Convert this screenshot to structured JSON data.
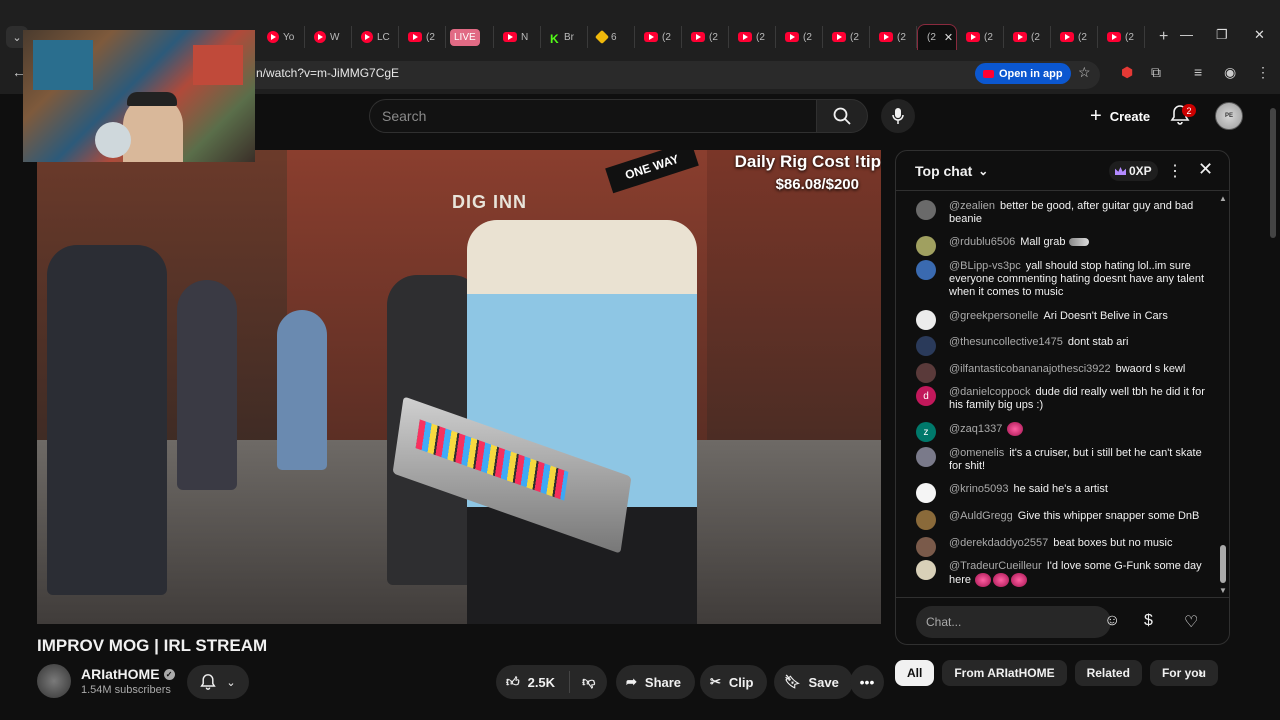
{
  "browser": {
    "tabs": [
      {
        "label": "Yo",
        "icon": "youtube-icon"
      },
      {
        "label": "W",
        "icon": "youtube-icon"
      },
      {
        "label": "LC",
        "icon": "youtube-icon"
      },
      {
        "label": "(2",
        "icon": "youtube-icon"
      },
      {
        "label": "LIVE",
        "icon": "live-badge"
      },
      {
        "label": "N",
        "icon": "youtube-icon"
      },
      {
        "label": "Br",
        "icon": "kick-icon"
      },
      {
        "label": "6",
        "icon": "binance-icon"
      },
      {
        "label": "(2",
        "icon": "youtube-icon"
      },
      {
        "label": "(2",
        "icon": "youtube-icon"
      },
      {
        "label": "(2",
        "icon": "youtube-icon"
      },
      {
        "label": "(2",
        "icon": "youtube-icon"
      },
      {
        "label": "(2",
        "icon": "youtube-icon"
      },
      {
        "label": "(2",
        "icon": "youtube-icon"
      },
      {
        "label": "(2",
        "icon": "youtube-icon"
      },
      {
        "label": "(2",
        "icon": "youtube-icon"
      },
      {
        "label": "(2",
        "icon": "youtube-icon"
      },
      {
        "label": "(2",
        "icon": "youtube-icon"
      }
    ],
    "active_tab_label": "(2",
    "url": "n/watch?v=m-JiMMG7CgE",
    "open_in_app": "Open in app"
  },
  "header": {
    "search_placeholder": "Search",
    "create_label": "Create",
    "notification_count": "2",
    "avatar_text": "PE"
  },
  "overlay": {
    "rig_cost_title": "Daily Rig Cost !tip",
    "rig_cost_value": "$86.08/$200",
    "street_sign_1": "DIG INN",
    "street_sign_2": "ONE WAY"
  },
  "video": {
    "title": "IMPROV MOG | IRL STREAM",
    "channel_name": "ARIatHOME",
    "subscribers": "1.54M subscribers",
    "likes": "2.5K",
    "share_label": "Share",
    "clip_label": "Clip",
    "save_label": "Save"
  },
  "chat": {
    "mode_label": "Top chat",
    "xp_label": "0XP",
    "input_placeholder": "Chat...",
    "messages": [
      {
        "author": "@zealien",
        "text": "better be good, after guitar guy and bad beanie",
        "avatar_color": "#6a6a6a",
        "avatar_letter": ""
      },
      {
        "author": "@rdublu6506",
        "text": "Mall grab",
        "avatar_color": "#a0a060",
        "avatar_letter": ""
      },
      {
        "author": "@BLipp-vs3pc",
        "text": "yall should stop hating lol..im sure everyone commenting hating doesnt have any talent when it comes to music",
        "avatar_color": "#3a6ab0",
        "avatar_letter": ""
      },
      {
        "author": "@greekpersonelle",
        "text": "Ari Doesn't Belive in Cars",
        "avatar_color": "#ececec",
        "avatar_letter": ""
      },
      {
        "author": "@thesuncollective1475",
        "text": "dont stab ari",
        "avatar_color": "#2a3a5a",
        "avatar_letter": ""
      },
      {
        "author": "@ilfantasticobananajothesci3922",
        "text": "bwaord s kewl",
        "avatar_color": "#5a3a3a",
        "avatar_letter": ""
      },
      {
        "author": "@danielcoppock",
        "text": "dude did really well tbh he did it for his family big ups :)",
        "avatar_color": "#c2185b",
        "avatar_letter": "d"
      },
      {
        "author": "@zaq1337",
        "text": "",
        "avatar_color": "#00796b",
        "avatar_letter": "z"
      },
      {
        "author": "@omenelis",
        "text": "it's a cruiser, but i still bet he can't skate for shit!",
        "avatar_color": "#7a7a8a",
        "avatar_letter": ""
      },
      {
        "author": "@krino5093",
        "text": "he said he's a artist",
        "avatar_color": "#f5f5f5",
        "avatar_letter": ""
      },
      {
        "author": "@AuldGregg",
        "text": "Give this whipper snapper some DnB",
        "avatar_color": "#8a6a3a",
        "avatar_letter": ""
      },
      {
        "author": "@derekdaddyo2557",
        "text": "beat boxes but no music",
        "avatar_color": "#7a5a4a",
        "avatar_letter": ""
      },
      {
        "author": "@TradeurCueilleur",
        "text": "I'd love some G-Funk some day here",
        "avatar_color": "#d8d0b8",
        "avatar_letter": ""
      }
    ]
  },
  "chips": [
    "All",
    "From ARIatHOME",
    "Related",
    "For you"
  ],
  "colors": {
    "background": "#0f0f0f",
    "surface": "#272727",
    "youtube_red": "#ff0033",
    "accent_blue": "#0b57d0"
  }
}
